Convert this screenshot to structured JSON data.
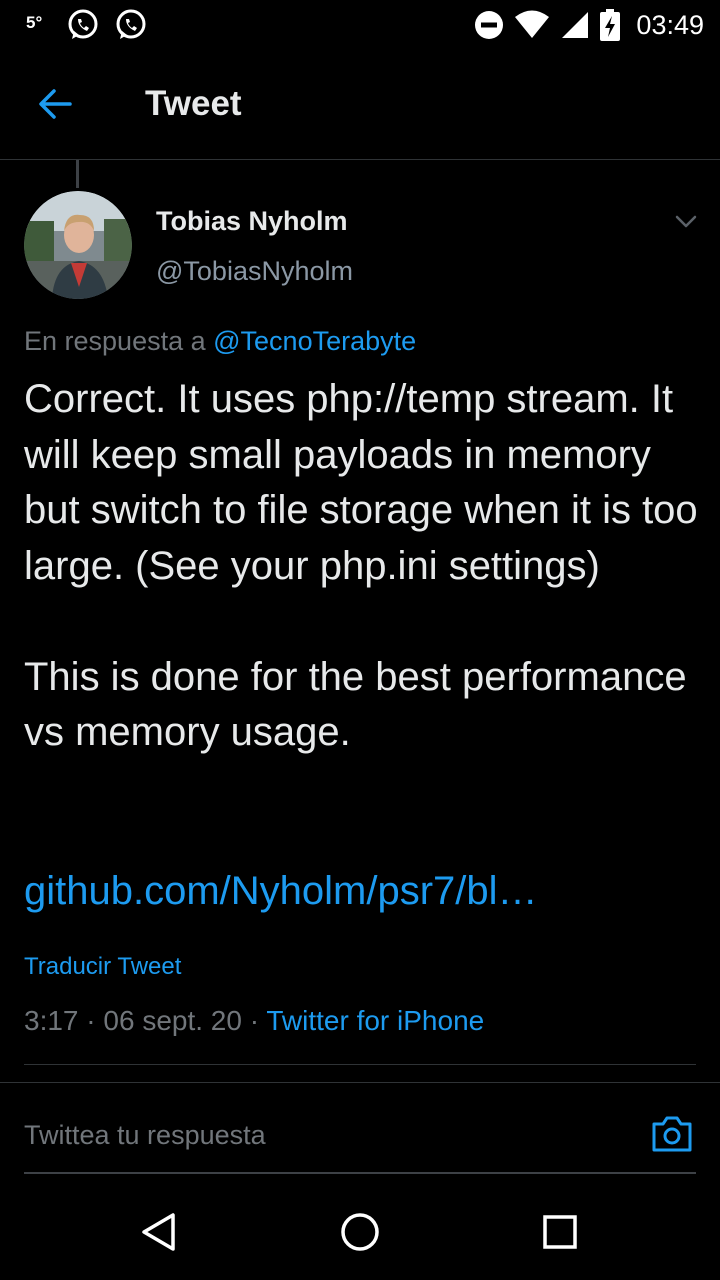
{
  "status_bar": {
    "temperature": "5°",
    "time": "03:49"
  },
  "header": {
    "title": "Tweet"
  },
  "tweet": {
    "display_name": "Tobias Nyholm",
    "handle": "@TobiasNyholm",
    "reply_prefix": "En respuesta a ",
    "reply_mention": "@TecnoTerabyte",
    "paragraphs": [
      "Correct. It uses php://temp stream. It will keep small payloads in memory but switch to file storage when it is too large. (See your php.ini settings)",
      "This is done for the best performance vs memory usage."
    ],
    "link": "github.com/Nyholm/psr7/bl…",
    "translate_label": "Traducir Tweet",
    "time": "3:17",
    "separator": " · ",
    "date": "06 sept. 20",
    "source": "Twitter for iPhone"
  },
  "composer": {
    "placeholder": "Twittea tu respuesta"
  },
  "colors": {
    "background": "#000000",
    "accent": "#1d9bf0",
    "muted": "#71767b"
  },
  "icons": [
    "whatsapp-icon",
    "do-not-disturb-icon",
    "wifi-icon",
    "signal-icon",
    "battery-charging-icon",
    "back-arrow-icon",
    "chevron-down-icon",
    "camera-icon",
    "nav-back-icon",
    "nav-home-icon",
    "nav-recents-icon"
  ]
}
